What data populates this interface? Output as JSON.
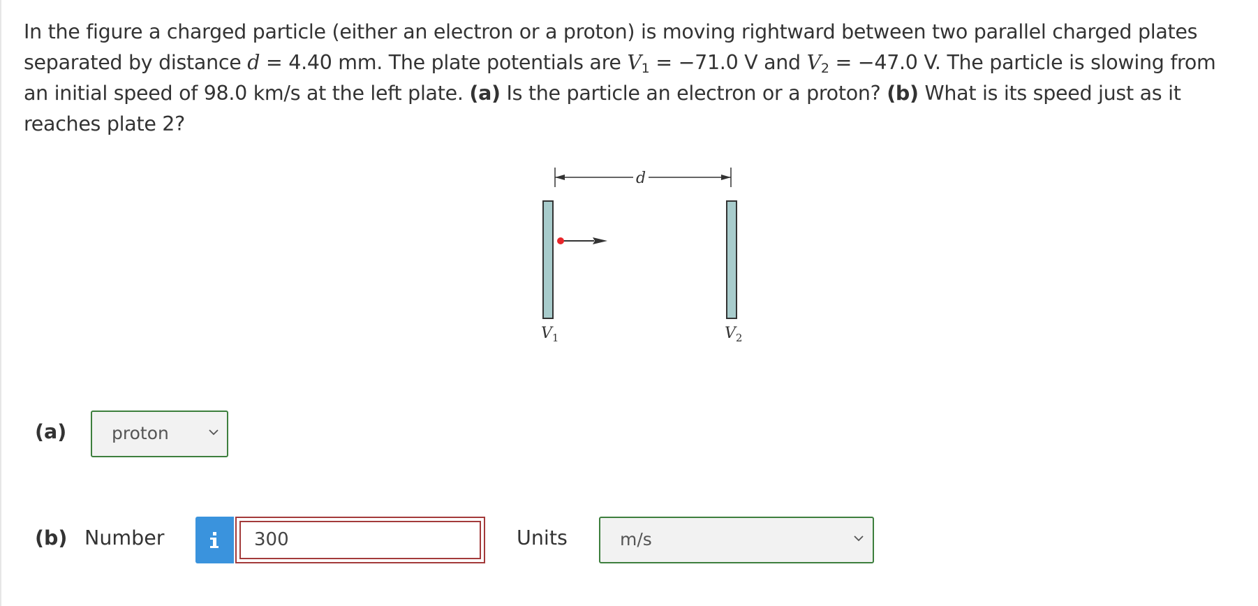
{
  "question": {
    "segments": [
      {
        "t": "In the figure a charged particle (either an electron or a proton) is moving rightward between two parallel charged plates separated by distance "
      },
      {
        "t": "d",
        "i": true
      },
      {
        "t": " = 4.40 mm. The plate potentials are "
      },
      {
        "t": "V",
        "i": true
      },
      {
        "t": "1",
        "sub": true
      },
      {
        "t": " = −71.0 V and "
      },
      {
        "t": "V",
        "i": true
      },
      {
        "t": "2",
        "sub": true
      },
      {
        "t": " = −47.0 V. The particle is slowing from an initial speed of 98.0 km/s at the left plate. "
      },
      {
        "t": "(a)",
        "b": true
      },
      {
        "t": " Is the particle an electron or a proton? "
      },
      {
        "t": "(b)",
        "b": true
      },
      {
        "t": " What is its speed just as it reaches plate 2?"
      }
    ]
  },
  "figure": {
    "distance_label": "d",
    "plate1_label": "V",
    "plate1_sub": "1",
    "plate2_label": "V",
    "plate2_sub": "2",
    "plate_color": "#a8cccc",
    "particle_color": "#e8262a"
  },
  "part_a": {
    "label": "(a)",
    "selected": "proton",
    "icon": "chevron-down-icon"
  },
  "part_b": {
    "label": "(b)",
    "number_label": "Number",
    "info_icon": "info-icon",
    "value": "300",
    "units_label": "Units",
    "units_selected": "m/s",
    "units_icon": "chevron-down-icon"
  },
  "colors": {
    "select_border": "#3d7f3d",
    "input_border": "#a33a3a",
    "info_button": "#3a93dd"
  }
}
